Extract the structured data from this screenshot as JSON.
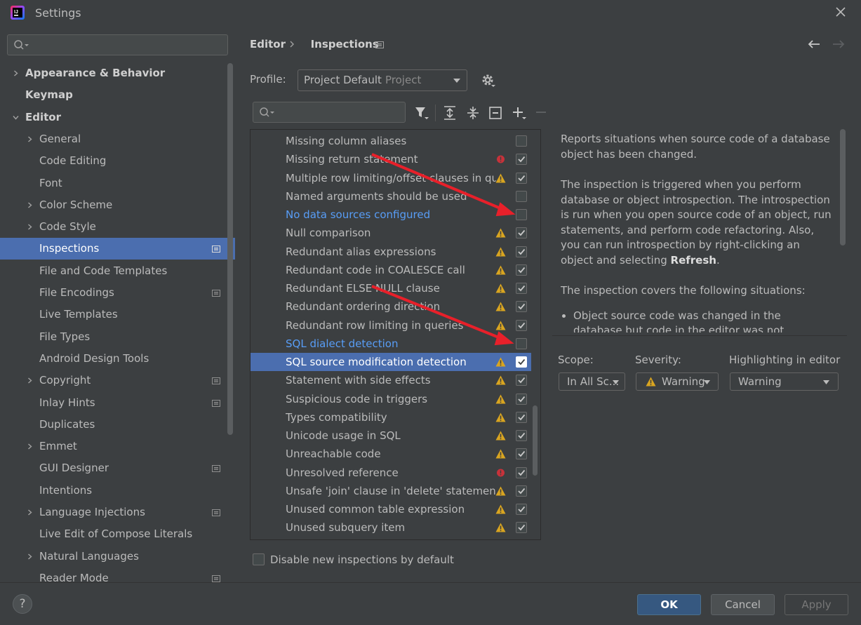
{
  "window": {
    "title": "Settings"
  },
  "sidebar": {
    "items": [
      {
        "label": "Appearance & Behavior",
        "expandable": true,
        "bold": true,
        "level": 0
      },
      {
        "label": "Keymap",
        "expandable": false,
        "bold": true,
        "level": 0
      },
      {
        "label": "Editor",
        "expandable": true,
        "expanded": true,
        "bold": true,
        "level": 0
      },
      {
        "label": "General",
        "expandable": true,
        "level": 1
      },
      {
        "label": "Code Editing",
        "level": 1
      },
      {
        "label": "Font",
        "level": 1
      },
      {
        "label": "Color Scheme",
        "expandable": true,
        "level": 1
      },
      {
        "label": "Code Style",
        "expandable": true,
        "level": 1
      },
      {
        "label": "Inspections",
        "level": 1,
        "selected": true,
        "pinned": true
      },
      {
        "label": "File and Code Templates",
        "level": 1
      },
      {
        "label": "File Encodings",
        "level": 1,
        "pinned": true
      },
      {
        "label": "Live Templates",
        "level": 1
      },
      {
        "label": "File Types",
        "level": 1
      },
      {
        "label": "Android Design Tools",
        "level": 1
      },
      {
        "label": "Copyright",
        "expandable": true,
        "level": 1,
        "pinned": true
      },
      {
        "label": "Inlay Hints",
        "level": 1,
        "pinned": true
      },
      {
        "label": "Duplicates",
        "level": 1
      },
      {
        "label": "Emmet",
        "expandable": true,
        "level": 1
      },
      {
        "label": "GUI Designer",
        "level": 1,
        "pinned": true
      },
      {
        "label": "Intentions",
        "level": 1
      },
      {
        "label": "Language Injections",
        "expandable": true,
        "level": 1,
        "pinned": true
      },
      {
        "label": "Live Edit of Compose Literals",
        "level": 1
      },
      {
        "label": "Natural Languages",
        "expandable": true,
        "level": 1
      },
      {
        "label": "Reader Mode",
        "level": 1,
        "pinned": true
      }
    ]
  },
  "header": {
    "breadcrumb": [
      "Editor",
      "Inspections"
    ]
  },
  "profile": {
    "label": "Profile:",
    "name": "Project Default",
    "scope": "Project"
  },
  "inspections": [
    {
      "label": "Missing column aliases",
      "severity": "none",
      "checked": false
    },
    {
      "label": "Missing return statement",
      "severity": "error",
      "checked": true
    },
    {
      "label": "Multiple row limiting/offset clauses in queries",
      "severity": "warning",
      "checked": true
    },
    {
      "label": "Named arguments should be used",
      "severity": "none",
      "checked": false
    },
    {
      "label": "No data sources configured",
      "severity": "none",
      "checked": false,
      "link": true
    },
    {
      "label": "Null comparison",
      "severity": "warning",
      "checked": true
    },
    {
      "label": "Redundant alias expressions",
      "severity": "warning",
      "checked": true
    },
    {
      "label": "Redundant code in COALESCE call",
      "severity": "warning",
      "checked": true
    },
    {
      "label": "Redundant ELSE NULL clause",
      "severity": "warning",
      "checked": true
    },
    {
      "label": "Redundant ordering direction",
      "severity": "warning",
      "checked": true
    },
    {
      "label": "Redundant row limiting in queries",
      "severity": "warning",
      "checked": true
    },
    {
      "label": "SQL dialect detection",
      "severity": "none",
      "checked": false,
      "link": true
    },
    {
      "label": "SQL source modification detection",
      "severity": "warning",
      "checked": true,
      "selected": true
    },
    {
      "label": "Statement with side effects",
      "severity": "warning",
      "checked": true
    },
    {
      "label": "Suspicious code in triggers",
      "severity": "warning",
      "checked": true
    },
    {
      "label": "Types compatibility",
      "severity": "warning",
      "checked": true
    },
    {
      "label": "Unicode usage in SQL",
      "severity": "warning",
      "checked": true
    },
    {
      "label": "Unreachable code",
      "severity": "warning",
      "checked": true
    },
    {
      "label": "Unresolved reference",
      "severity": "error",
      "checked": true
    },
    {
      "label": "Unsafe 'join' clause in 'delete' statement",
      "severity": "warning",
      "checked": true
    },
    {
      "label": "Unused common table expression",
      "severity": "warning",
      "checked": true
    },
    {
      "label": "Unused subquery item",
      "severity": "warning",
      "checked": true
    }
  ],
  "description": {
    "p1": "Reports situations when source code of a database object has been changed.",
    "p2_before": "The inspection is triggered when you perform database or object introspection. The introspection is run when you open source code of an object, run statements, and perform code refactoring. Also, you can run introspection by right-clicking an object and selecting ",
    "p2_bold": "Refresh",
    "p2_after": ".",
    "p3": "The inspection covers the following situations:",
    "bullet1": "Object source code was changed in the database but code in the editor was not updated. Works in"
  },
  "options": {
    "scope_label": "Scope:",
    "scope_value": "In All Sc...",
    "severity_label": "Severity:",
    "severity_value": "Warning",
    "highlight_label": "Highlighting in editor",
    "highlight_value": "Warning"
  },
  "footer": {
    "disable_label": "Disable new inspections by default",
    "help": "?",
    "ok": "OK",
    "cancel": "Cancel",
    "apply": "Apply"
  },
  "colors": {
    "background": "#3c3f41",
    "selection": "#4b6eaf",
    "link": "#589df6",
    "warning": "#d9a520",
    "error": "#c7323a",
    "annotation_arrow": "#e8202a"
  }
}
